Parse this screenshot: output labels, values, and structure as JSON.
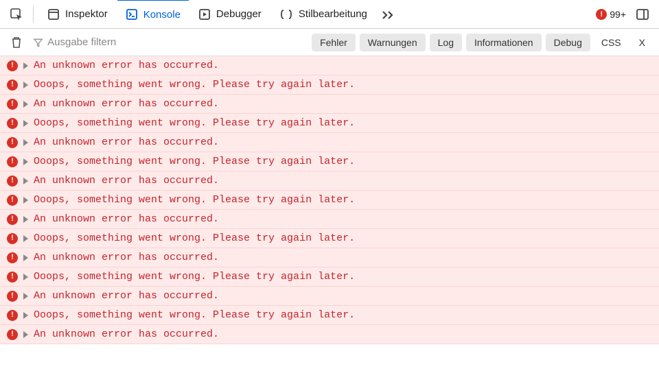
{
  "topbar": {
    "tabs": [
      {
        "id": "inspector",
        "label": "Inspektor"
      },
      {
        "id": "console",
        "label": "Konsole"
      },
      {
        "id": "debugger",
        "label": "Debugger"
      },
      {
        "id": "styleeditor",
        "label": "Stilbearbeitung"
      }
    ],
    "error_count": "99+"
  },
  "filterbar": {
    "placeholder": "Ausgabe filtern",
    "pills": {
      "errors": "Fehler",
      "warnings": "Warnungen",
      "log": "Log",
      "info": "Informationen",
      "debug": "Debug",
      "css": "CSS",
      "x": "X"
    }
  },
  "logs": [
    {
      "msg": "An unknown error has occurred."
    },
    {
      "msg": "Ooops, something went wrong. Please try again later."
    },
    {
      "msg": "An unknown error has occurred."
    },
    {
      "msg": "Ooops, something went wrong. Please try again later."
    },
    {
      "msg": "An unknown error has occurred."
    },
    {
      "msg": "Ooops, something went wrong. Please try again later."
    },
    {
      "msg": "An unknown error has occurred."
    },
    {
      "msg": "Ooops, something went wrong. Please try again later."
    },
    {
      "msg": "An unknown error has occurred."
    },
    {
      "msg": "Ooops, something went wrong. Please try again later."
    },
    {
      "msg": "An unknown error has occurred."
    },
    {
      "msg": "Ooops, something went wrong. Please try again later."
    },
    {
      "msg": "An unknown error has occurred."
    },
    {
      "msg": "Ooops, something went wrong. Please try again later."
    },
    {
      "msg": "An unknown error has occurred."
    }
  ]
}
